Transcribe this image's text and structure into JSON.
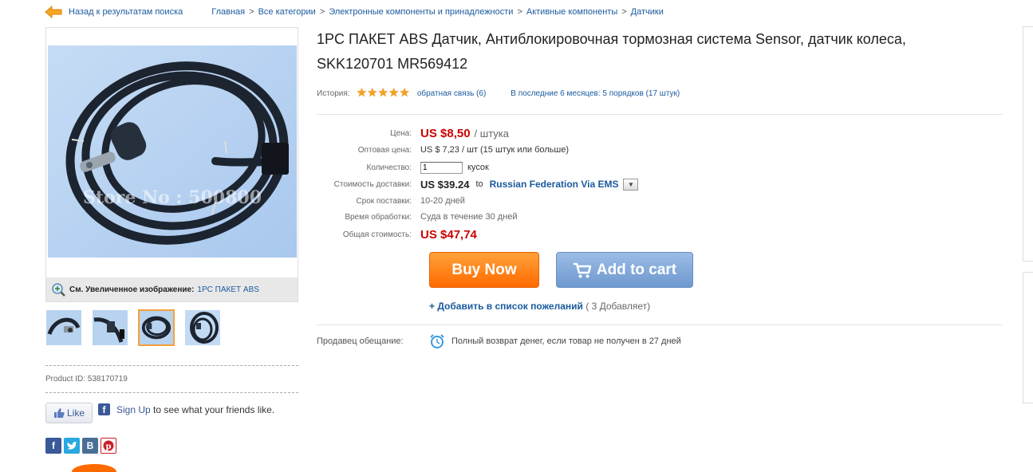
{
  "breadcrumb": {
    "back_label": "Назад к результатам поиска",
    "items": [
      "Главная",
      "Все категории",
      "Электронные компоненты и принадлежности",
      "Активные компоненты",
      "Датчики"
    ],
    "separator": ">"
  },
  "product": {
    "title": "1PC ПАКЕТ ABS Датчик, Антиблокировочная тормозная система Sensor, датчик колеса, SKK120701 MR569412",
    "image_watermark": "Store No : 500800",
    "zoom_label": "См. Увеличенное изображение:",
    "zoom_link": "1PC ПАКЕТ ABS",
    "product_id": "Product ID: 538170719",
    "rating_stars": 5
  },
  "history": {
    "label": "История:",
    "feedback": "обратная связь (6)",
    "orders": "В последние 6 месяцев: 5 порядков (17 штук)"
  },
  "pricing": {
    "price_label": "Цена:",
    "price": "US $8,50",
    "price_unit": "/ штука",
    "wholesale_label": "Оптовая цена:",
    "wholesale": "US $ 7,23 / шт (15 штук или больше)",
    "qty_label": "Количество:",
    "qty_value": "1",
    "qty_unit": "кусок",
    "shipping_label": "Стоимость доставки:",
    "shipping_price": "US $39.24",
    "shipping_to": "to",
    "shipping_method": "Russian Federation Via EMS",
    "delivery_label": "Срок поставки:",
    "delivery": "10-20 дней",
    "processing_label": "Время обработки:",
    "processing": "Суда в течение 30 дней",
    "total_label": "Общая стоимость:",
    "total": "US $47,74"
  },
  "actions": {
    "buy_now": "Buy Now",
    "add_to_cart": "Add to cart",
    "wishlist": "+ Добавить в список пожеланий",
    "wishlist_count": "( 3 Добавляет)"
  },
  "seller": {
    "label": "Продавец обещание:",
    "promise": "Полный возврат денег, если товар не получен в 27 дней"
  },
  "social": {
    "like": "Like",
    "signup_link": "Sign Up",
    "signup_text": " to see what your friends like.",
    "icons": [
      "facebook-icon",
      "twitter-icon",
      "vk-icon",
      "pinterest-icon"
    ]
  },
  "colors": {
    "price_red": "#cc0000",
    "link_blue": "#1a5a9e",
    "buy_orange": "#ff6a00",
    "cart_blue": "#7aa3d8",
    "star": "#f7a01e"
  }
}
